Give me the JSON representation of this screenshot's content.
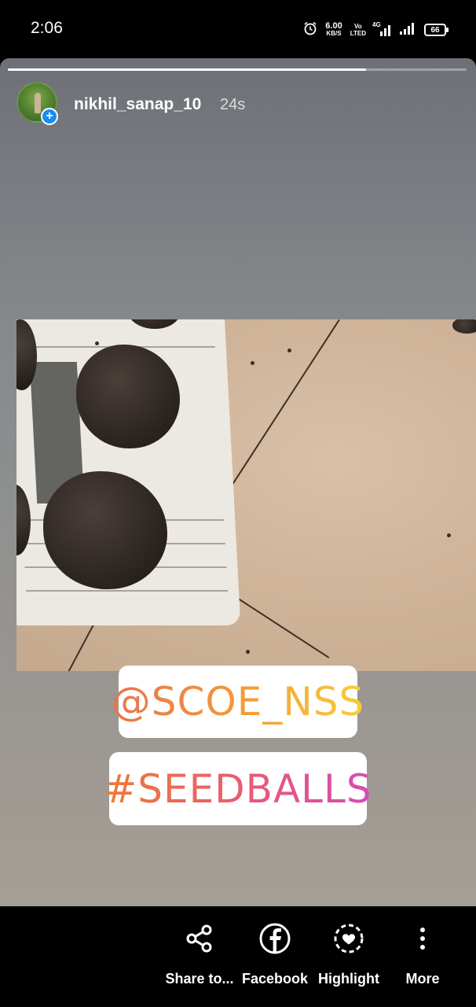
{
  "status_bar": {
    "time": "2:06",
    "net_speed_value": "6.00",
    "net_speed_unit": "KB/S",
    "volte_top": "Vo",
    "volte_bottom": "LTED",
    "network_type": "4G",
    "battery": "66",
    "icons": [
      "alarm-icon",
      "signal-icon",
      "signal-icon",
      "battery-icon"
    ]
  },
  "story": {
    "progress": 0.78,
    "username": "nikhil_sanap_10",
    "time_ago": "24s",
    "stickers": {
      "mention": "@SCOE_NSS",
      "hashtag": "#SEEDBALLS"
    }
  },
  "actions": [
    {
      "label": "Share to...",
      "icon": "share-icon"
    },
    {
      "label": "Facebook",
      "icon": "facebook-icon"
    },
    {
      "label": "Highlight",
      "icon": "highlight-icon"
    },
    {
      "label": "More",
      "icon": "more-vertical-icon"
    }
  ],
  "colors": {
    "plus_badge": "#1a8cf0",
    "mention_gradient": [
      "#e9734a",
      "#f7cd3a"
    ],
    "hashtag_gradient": [
      "#ee7b36",
      "#d64bb7"
    ]
  }
}
